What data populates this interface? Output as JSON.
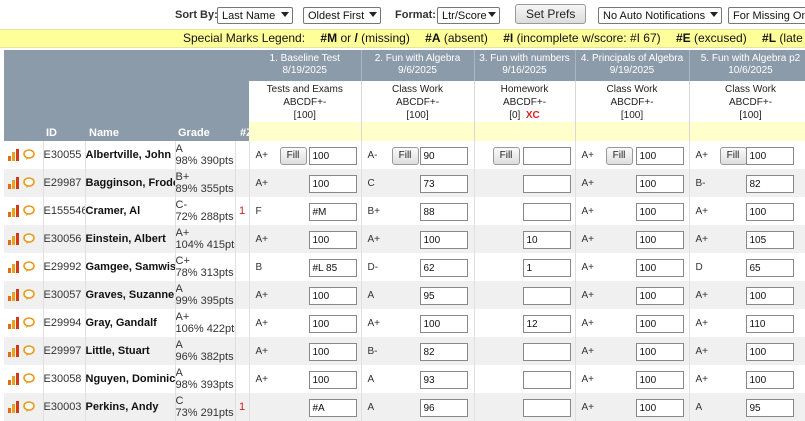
{
  "toolbar": {
    "sort_label": "Sort By:",
    "sort_value": "Last Name",
    "order_value": "Oldest First",
    "format_label": "Format:",
    "format_value": "Ltr/Score",
    "set_prefs_label": "Set Prefs",
    "notif_value": "No Auto Notifications",
    "missing_value": "For Missing Only"
  },
  "legend": {
    "title": "Special Marks Legend:",
    "m_code": "#M",
    "m_or": "or",
    "m_slash": "/",
    "m_desc": "(missing)",
    "a_code": "#A",
    "a_desc": "(absent)",
    "i_code": "#I",
    "i_desc": "(incomplete w/score: #I 67)",
    "e_code": "#E",
    "e_desc": "(excused)",
    "l_code": "#L",
    "l_desc": "(late w/score"
  },
  "columns": {
    "id": "ID",
    "name": "Name",
    "grade": "Grade",
    "z": "#Z"
  },
  "fill_label": "Fill",
  "assignments": [
    {
      "title": "1. Baseline Test",
      "date": "8/19/2025",
      "category": "Tests and Exams",
      "scale": "ABCDF+-",
      "points": "[100]",
      "xc": ""
    },
    {
      "title": "2. Fun with Algebra",
      "date": "9/6/2025",
      "category": "Class Work",
      "scale": "ABCDF+-",
      "points": "[100]",
      "xc": ""
    },
    {
      "title": "3. Fun with numbers",
      "date": "9/16/2025",
      "category": "Homework",
      "scale": "ABCDF+-",
      "points": "[0]",
      "xc": "XC"
    },
    {
      "title": "4. Principals of Algebra",
      "date": "9/19/2025",
      "category": "Class Work",
      "scale": "ABCDF+-",
      "points": "[100]",
      "xc": ""
    },
    {
      "title": "5. Fun with Algebra p2",
      "date": "10/6/2025",
      "category": "Class Work",
      "scale": "ABCDF+-",
      "points": "[100]",
      "xc": ""
    }
  ],
  "students": [
    {
      "id": "E30055",
      "name": "Albertville, John",
      "grade": "A",
      "pts": "98% 390pts",
      "flag": "",
      "scores": [
        [
          "A+",
          "100"
        ],
        [
          "A-",
          "90"
        ],
        [
          "",
          ""
        ],
        [
          "A+",
          "100"
        ],
        [
          "A+",
          "100"
        ]
      ]
    },
    {
      "id": "E29987",
      "name": "Bagginson, Frodo",
      "grade": "B+",
      "pts": "89% 355pts",
      "flag": "",
      "scores": [
        [
          "A+",
          "100"
        ],
        [
          "C",
          "73"
        ],
        [
          "",
          ""
        ],
        [
          "A+",
          "100"
        ],
        [
          "B-",
          "82"
        ]
      ]
    },
    {
      "id": "E155546",
      "name": "Cramer, Al",
      "grade": "C-",
      "pts": "72% 288pts",
      "flag": "1",
      "scores": [
        [
          "F",
          "#M"
        ],
        [
          "B+",
          "88"
        ],
        [
          "",
          ""
        ],
        [
          "A+",
          "100"
        ],
        [
          "A+",
          "100"
        ]
      ]
    },
    {
      "id": "E30056",
      "name": "Einstein, Albert",
      "grade": "A+",
      "pts": "104% 415pts",
      "flag": "",
      "scores": [
        [
          "A+",
          "100"
        ],
        [
          "A+",
          "100"
        ],
        [
          "",
          "10"
        ],
        [
          "A+",
          "100"
        ],
        [
          "A+",
          "105"
        ]
      ]
    },
    {
      "id": "E29992",
      "name": "Gamgee, Samwise",
      "grade": "C+",
      "pts": "78% 313pts",
      "flag": "",
      "scores": [
        [
          "B",
          "#L 85"
        ],
        [
          "D-",
          "62"
        ],
        [
          "",
          "1"
        ],
        [
          "A+",
          "100"
        ],
        [
          "D",
          "65"
        ]
      ]
    },
    {
      "id": "E30057",
      "name": "Graves, Suzanne",
      "grade": "A",
      "pts": "99% 395pts",
      "flag": "",
      "scores": [
        [
          "A+",
          "100"
        ],
        [
          "A",
          "95"
        ],
        [
          "",
          ""
        ],
        [
          "A+",
          "100"
        ],
        [
          "A+",
          "100"
        ]
      ]
    },
    {
      "id": "E29994",
      "name": "Gray, Gandalf",
      "grade": "A+",
      "pts": "106% 422pts",
      "flag": "",
      "scores": [
        [
          "A+",
          "100"
        ],
        [
          "A+",
          "100"
        ],
        [
          "",
          "12"
        ],
        [
          "A+",
          "100"
        ],
        [
          "A+",
          "110"
        ]
      ]
    },
    {
      "id": "E29997",
      "name": "Little, Stuart",
      "grade": "A",
      "pts": "96% 382pts",
      "flag": "",
      "scores": [
        [
          "A+",
          "100"
        ],
        [
          "B-",
          "82"
        ],
        [
          "",
          ""
        ],
        [
          "A+",
          "100"
        ],
        [
          "A+",
          "100"
        ]
      ]
    },
    {
      "id": "E30058",
      "name": "Nguyen, Dominic",
      "grade": "A",
      "pts": "98% 393pts",
      "flag": "",
      "scores": [
        [
          "A+",
          "100"
        ],
        [
          "A",
          "93"
        ],
        [
          "",
          ""
        ],
        [
          "A+",
          "100"
        ],
        [
          "A+",
          "100"
        ]
      ]
    },
    {
      "id": "E30003",
      "name": "Perkins, Andy",
      "grade": "C",
      "pts": "73% 291pts",
      "flag": "1",
      "scores": [
        [
          "",
          "#A"
        ],
        [
          "A",
          "96"
        ],
        [
          "",
          ""
        ],
        [
          "A+",
          "100"
        ],
        [
          "A",
          "95"
        ]
      ]
    }
  ],
  "colors": {
    "header_bg": "#8c9baa",
    "legend_bg": "#ffff99",
    "info_yellow": "#ffffcc",
    "flag_red": "#cc2222"
  }
}
